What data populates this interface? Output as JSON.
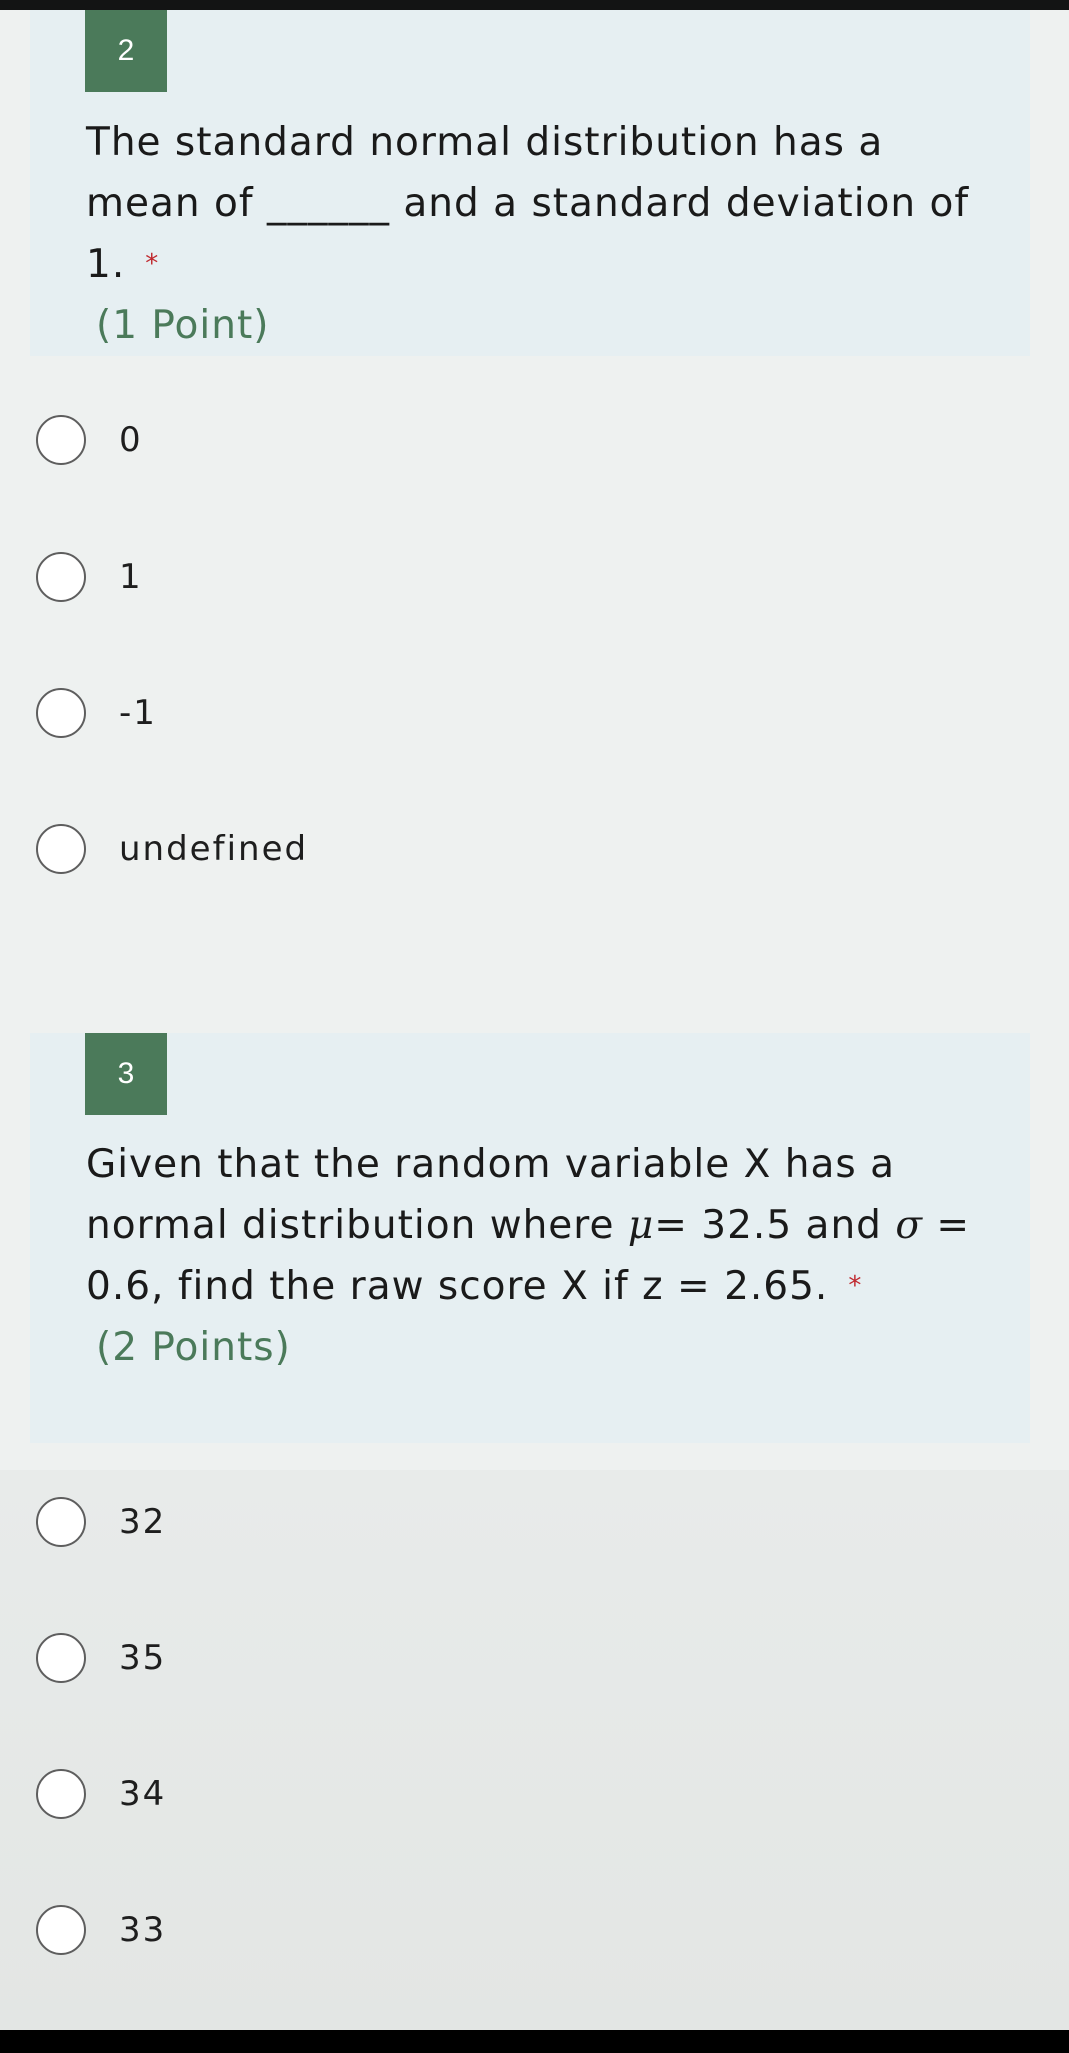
{
  "questions": [
    {
      "number": "2",
      "text": "The standard normal distribution has a mean of ______ and a standard deviation of 1.",
      "required_marker": "*",
      "points": "(1 Point)",
      "options": [
        "0",
        "1",
        "-1",
        "undefined"
      ]
    },
    {
      "number": "3",
      "text_before_mu": "Given that the random variable X has a normal distribution where ",
      "mu_symbol": "μ",
      "text_after_mu": "= 32.5 and ",
      "sigma_symbol": "σ",
      "text_after_sigma": " = 0.6, find the raw score X if z = 2.65.",
      "required_marker": "*",
      "points": "(2 Points)",
      "options": [
        "32",
        "35",
        "34",
        "33"
      ]
    }
  ],
  "colors": {
    "accent": "#4b7a5a",
    "required": "#c0292f",
    "card_bg": "#e6eff2"
  }
}
